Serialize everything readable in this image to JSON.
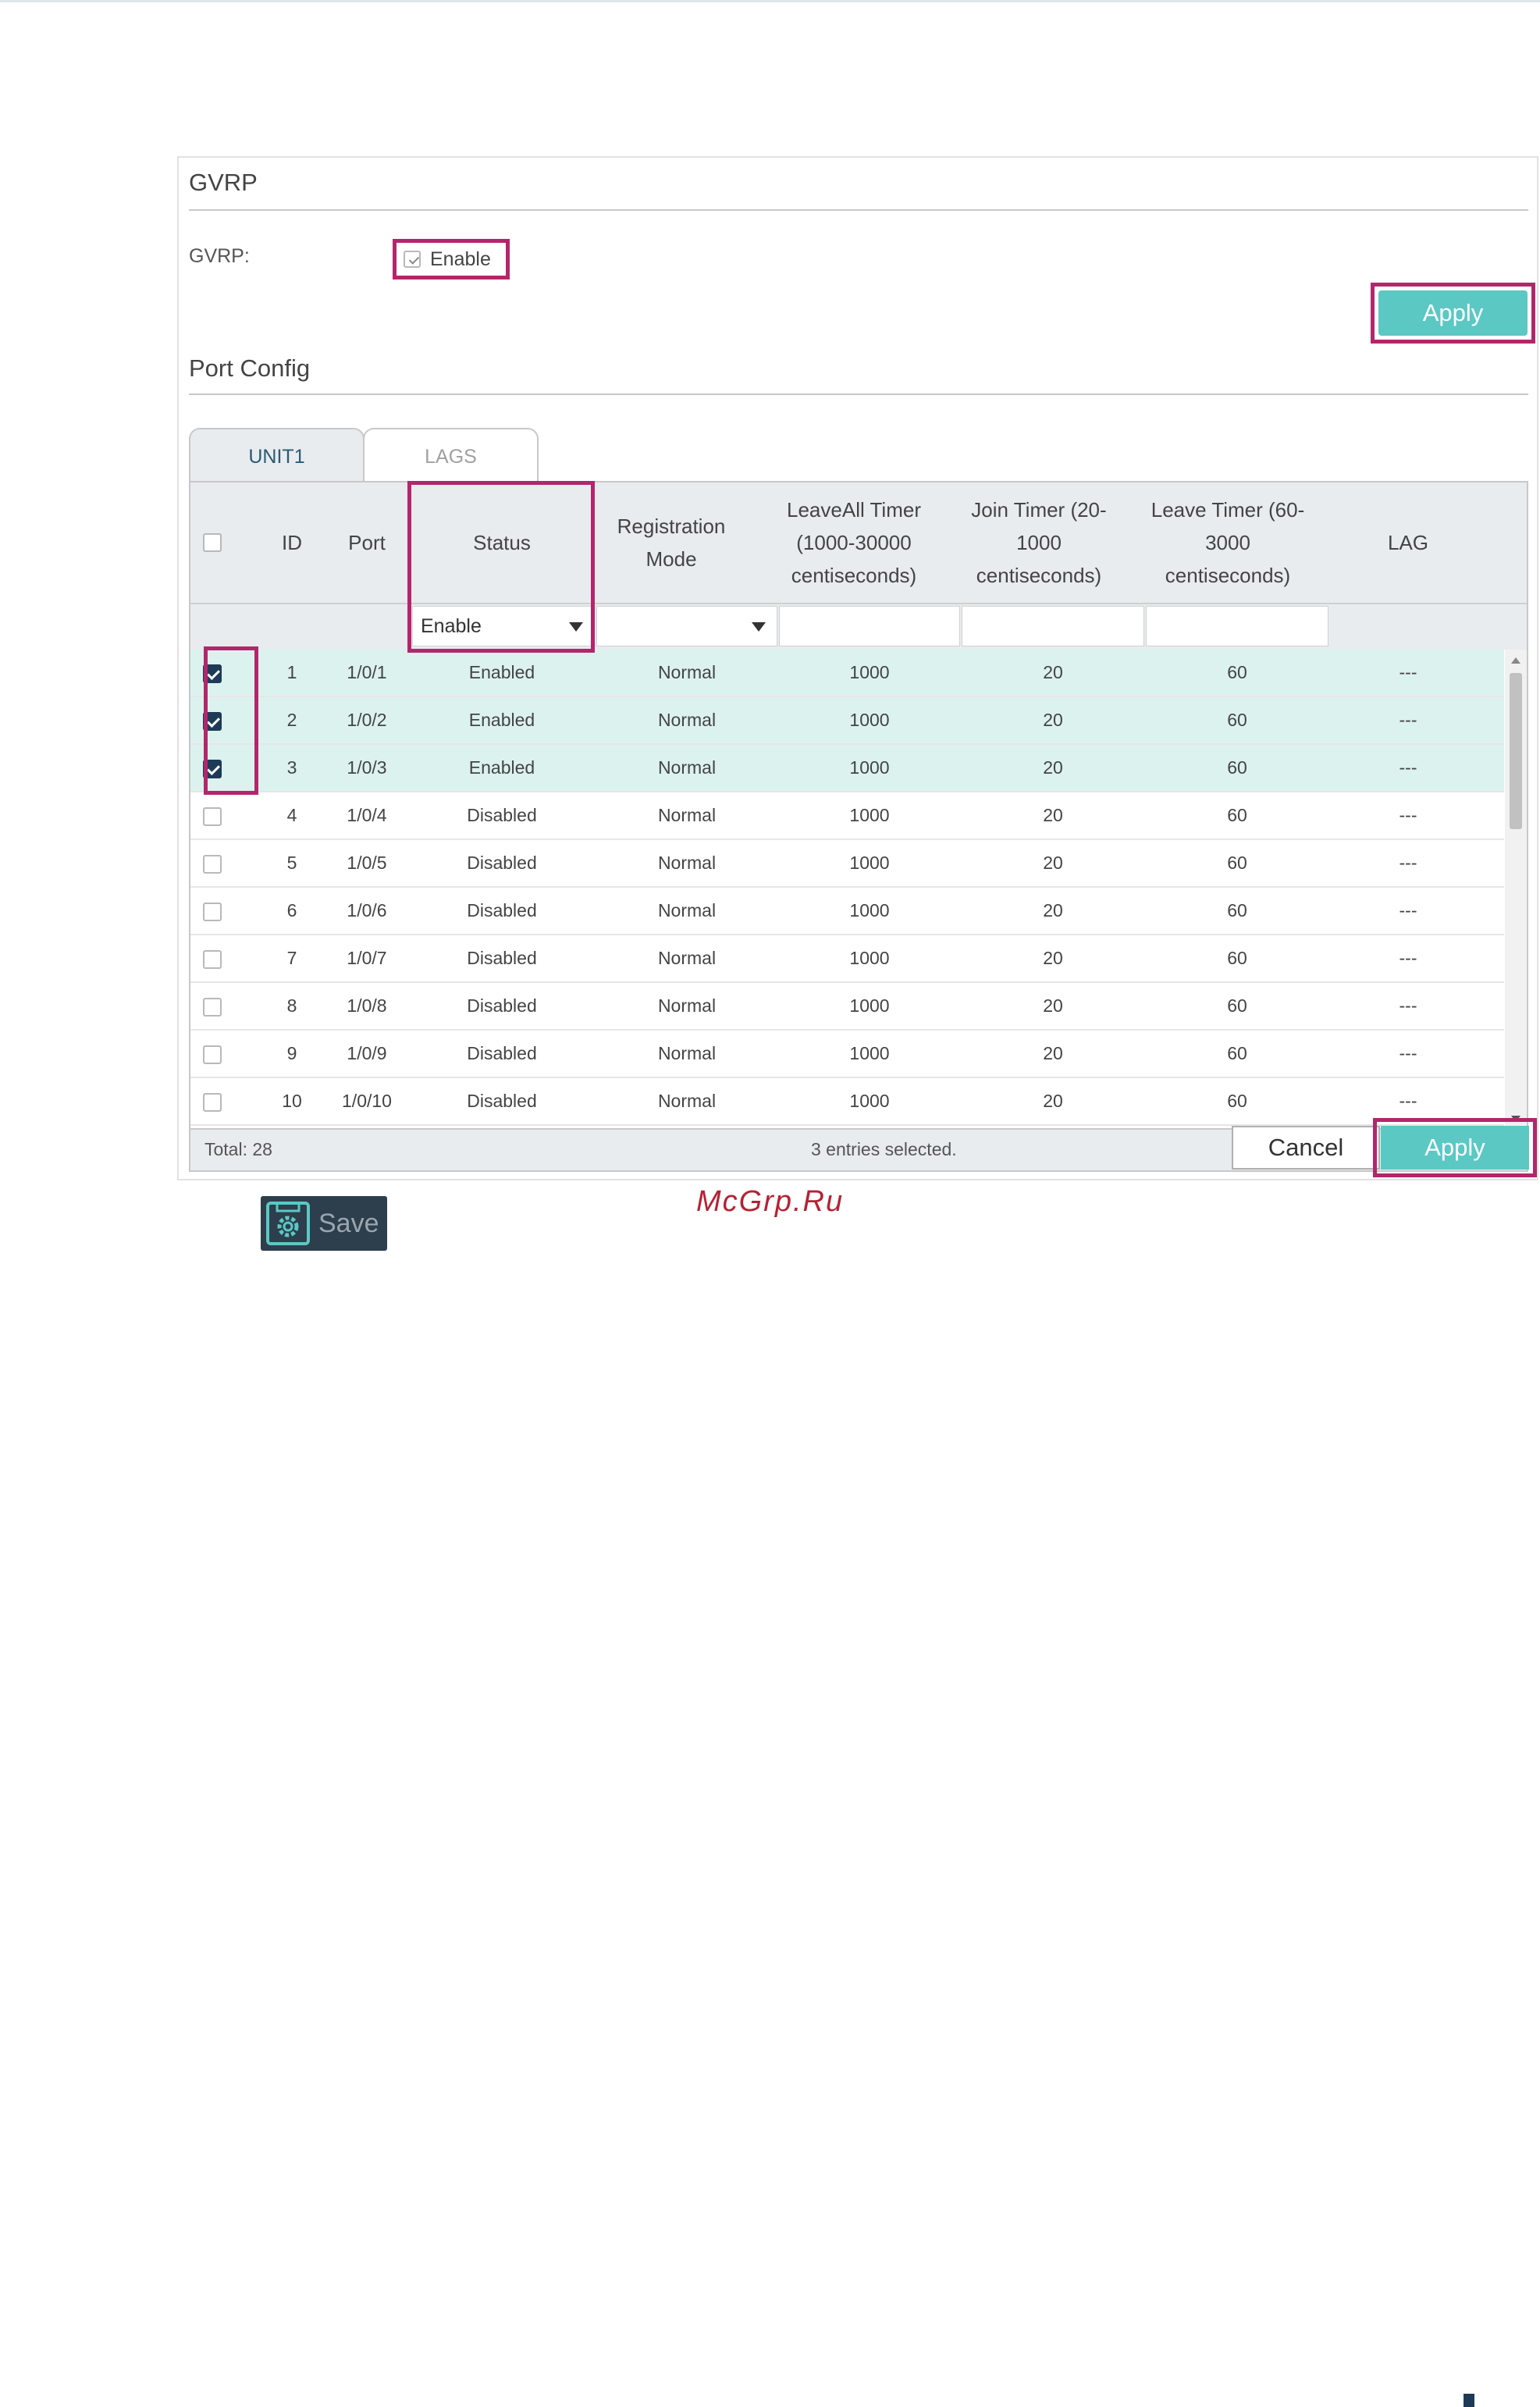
{
  "gvrp": {
    "section_title": "GVRP",
    "label": "GVRP:",
    "enable_label": "Enable",
    "enable_checked": true,
    "apply_label": "Apply"
  },
  "port_config": {
    "section_title": "Port Config",
    "tabs": [
      {
        "label": "UNIT1",
        "active": true
      },
      {
        "label": "LAGS",
        "active": false
      }
    ],
    "columns": {
      "id": "ID",
      "port": "Port",
      "status": "Status",
      "registration_mode": "Registration Mode",
      "leaveall_timer": "LeaveAll Timer (1000-30000 centiseconds)",
      "join_timer": "Join Timer (20-1000 centiseconds)",
      "leave_timer": "Leave Timer (60-3000 centiseconds)",
      "lag": "LAG"
    },
    "filters": {
      "status_value": "Enable",
      "registration_mode_value": ""
    },
    "rows": [
      {
        "checked": true,
        "id": "1",
        "port": "1/0/1",
        "status": "Enabled",
        "mode": "Normal",
        "leaveall": "1000",
        "join": "20",
        "leave": "60",
        "lag": "---"
      },
      {
        "checked": true,
        "id": "2",
        "port": "1/0/2",
        "status": "Enabled",
        "mode": "Normal",
        "leaveall": "1000",
        "join": "20",
        "leave": "60",
        "lag": "---"
      },
      {
        "checked": true,
        "id": "3",
        "port": "1/0/3",
        "status": "Enabled",
        "mode": "Normal",
        "leaveall": "1000",
        "join": "20",
        "leave": "60",
        "lag": "---"
      },
      {
        "checked": false,
        "id": "4",
        "port": "1/0/4",
        "status": "Disabled",
        "mode": "Normal",
        "leaveall": "1000",
        "join": "20",
        "leave": "60",
        "lag": "---"
      },
      {
        "checked": false,
        "id": "5",
        "port": "1/0/5",
        "status": "Disabled",
        "mode": "Normal",
        "leaveall": "1000",
        "join": "20",
        "leave": "60",
        "lag": "---"
      },
      {
        "checked": false,
        "id": "6",
        "port": "1/0/6",
        "status": "Disabled",
        "mode": "Normal",
        "leaveall": "1000",
        "join": "20",
        "leave": "60",
        "lag": "---"
      },
      {
        "checked": false,
        "id": "7",
        "port": "1/0/7",
        "status": "Disabled",
        "mode": "Normal",
        "leaveall": "1000",
        "join": "20",
        "leave": "60",
        "lag": "---"
      },
      {
        "checked": false,
        "id": "8",
        "port": "1/0/8",
        "status": "Disabled",
        "mode": "Normal",
        "leaveall": "1000",
        "join": "20",
        "leave": "60",
        "lag": "---"
      },
      {
        "checked": false,
        "id": "9",
        "port": "1/0/9",
        "status": "Disabled",
        "mode": "Normal",
        "leaveall": "1000",
        "join": "20",
        "leave": "60",
        "lag": "---"
      },
      {
        "checked": false,
        "id": "10",
        "port": "1/0/10",
        "status": "Disabled",
        "mode": "Normal",
        "leaveall": "1000",
        "join": "20",
        "leave": "60",
        "lag": "---"
      }
    ],
    "footer": {
      "total": "Total: 28",
      "selected": "3 entries selected.",
      "cancel_label": "Cancel",
      "apply_label": "Apply"
    }
  },
  "save": {
    "label": "Save",
    "icon": "save-gear-icon"
  },
  "watermark": "McGrp.Ru",
  "colors": {
    "accent": "#5bc8c4",
    "highlight_border": "#b3266b",
    "selected_row": "#dcf2ef",
    "header_bg": "#e8ecee",
    "checkbox_checked": "#1f3a57"
  }
}
